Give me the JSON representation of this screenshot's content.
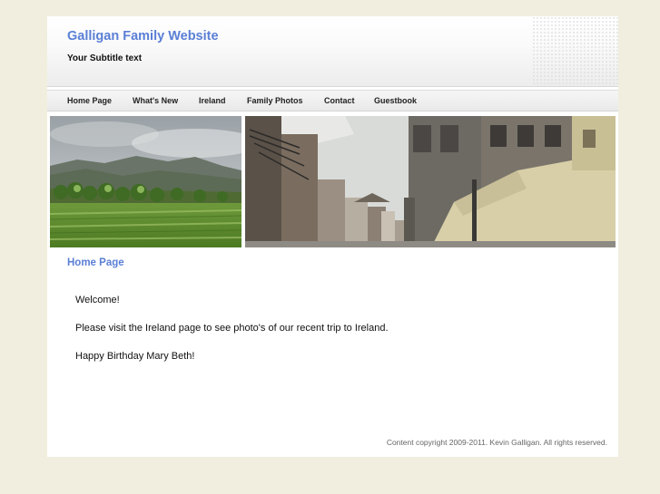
{
  "header": {
    "title": "Galligan Family Website",
    "subtitle": "Your Subtitle text"
  },
  "nav": {
    "items": [
      {
        "label": "Home Page"
      },
      {
        "label": "What's New"
      },
      {
        "label": "Ireland"
      },
      {
        "label": "Family Photos"
      },
      {
        "label": "Contact"
      },
      {
        "label": "Guestbook"
      }
    ]
  },
  "main": {
    "heading": "Home Page",
    "paragraphs": [
      "Welcome!",
      "Please visit the Ireland page to see photo's of our recent trip to Ireland.",
      "Happy Birthday Mary Beth!"
    ]
  },
  "footer": {
    "copyright": "Content copyright 2009-2011. Kevin Galligan. All rights reserved."
  },
  "colors": {
    "accent": "#5a7fd6",
    "page_background": "#f1eedf"
  }
}
